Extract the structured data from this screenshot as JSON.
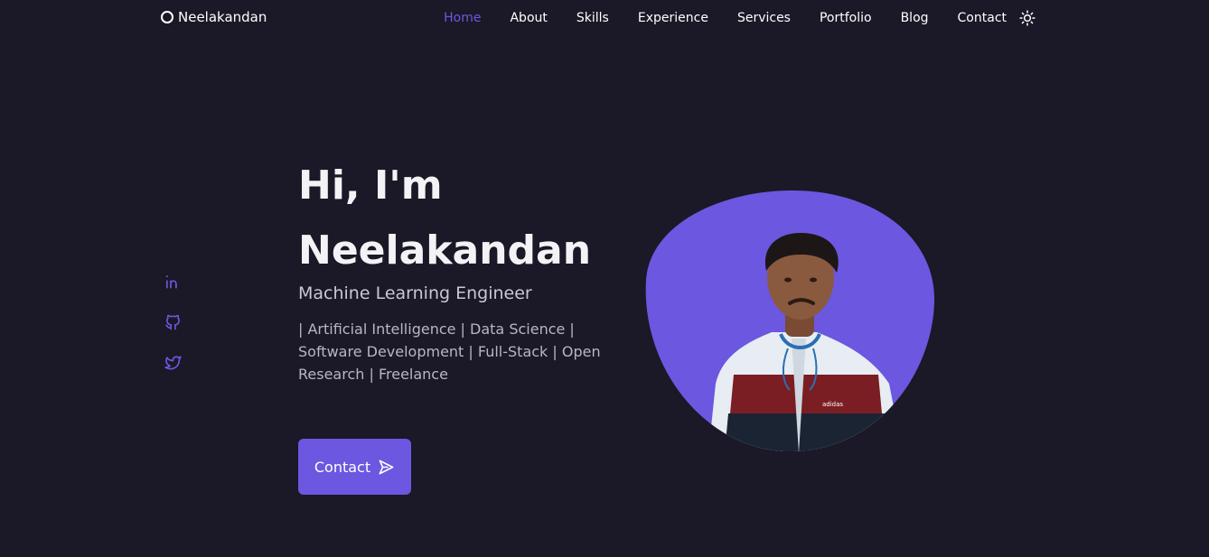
{
  "brand": {
    "name": "Neelakandan"
  },
  "nav": {
    "items": [
      {
        "label": "Home",
        "active": true
      },
      {
        "label": "About"
      },
      {
        "label": "Skills"
      },
      {
        "label": "Experience"
      },
      {
        "label": "Services"
      },
      {
        "label": "Portfolio"
      },
      {
        "label": "Blog"
      },
      {
        "label": "Contact"
      }
    ],
    "theme_icon": "sun-icon"
  },
  "socials": [
    {
      "icon": "linkedin-icon"
    },
    {
      "icon": "github-icon"
    },
    {
      "icon": "twitter-icon"
    }
  ],
  "hero": {
    "greeting": "Hi, I'm",
    "name": "Neelakandan",
    "role": "Machine Learning Engineer",
    "description": "| Artificial Intelligence | Data Science | Software Development | Full-Stack | Open Research | Freelance",
    "button_label": "Contact",
    "button_icon": "send-icon"
  },
  "colors": {
    "background": "#1b1827",
    "accent": "#6c57e0",
    "text": "#ffffff"
  }
}
